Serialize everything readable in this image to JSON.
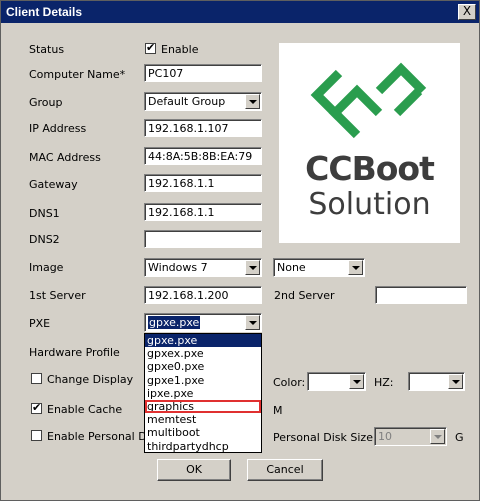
{
  "window": {
    "title": "Client Details",
    "close_glyph": "X"
  },
  "labels": {
    "status": "Status",
    "computer_name": "Computer Name*",
    "group": "Group",
    "ip_address": "IP Address",
    "mac_address": "MAC Address",
    "gateway": "Gateway",
    "dns1": "DNS1",
    "dns2": "DNS2",
    "image": "Image",
    "first_server": "1st Server",
    "second_server": "2nd Server",
    "pxe": "PXE",
    "hardware_profile": "Hardware Profile",
    "change_display": "Change Display",
    "enable_cache": "Enable Cache",
    "enable_personal_disk": "Enable Personal Disk",
    "color": "Color:",
    "hz": "HZ:",
    "cache_unit": "M",
    "personal_disk_size": "Personal Disk Size",
    "personal_disk_unit": "G"
  },
  "fields": {
    "status_enable": {
      "label": "Enable",
      "checked": true
    },
    "computer_name": "PC107",
    "group": "Default Group",
    "ip_address": "192.168.1.107",
    "mac_address": "44:8A:5B:8B:EA:79",
    "gateway": "192.168.1.1",
    "dns1": "192.168.1.1",
    "dns2": "",
    "image": "Windows 7",
    "image2": "None",
    "first_server": "192.168.1.200",
    "second_server": "",
    "pxe": "gpxe.pxe",
    "color": "",
    "hz": "",
    "personal_disk_size": "10",
    "change_display_checked": false,
    "enable_cache_checked": true,
    "enable_personal_disk_checked": false
  },
  "pxe_dropdown": {
    "options": [
      "gpxe.pxe",
      "gpxex.pxe",
      "gpxe0.pxe",
      "gpxe1.pxe",
      "ipxe.pxe",
      "graphics",
      "memtest",
      "multiboot",
      "thirdpartydhcp"
    ],
    "selected_index": 0,
    "highlighted_index": 5
  },
  "logo": {
    "line1": "CCBoot",
    "line2": "Solution",
    "brand_color": "#2a9d4e"
  },
  "buttons": {
    "ok": "OK",
    "cancel": "Cancel"
  }
}
